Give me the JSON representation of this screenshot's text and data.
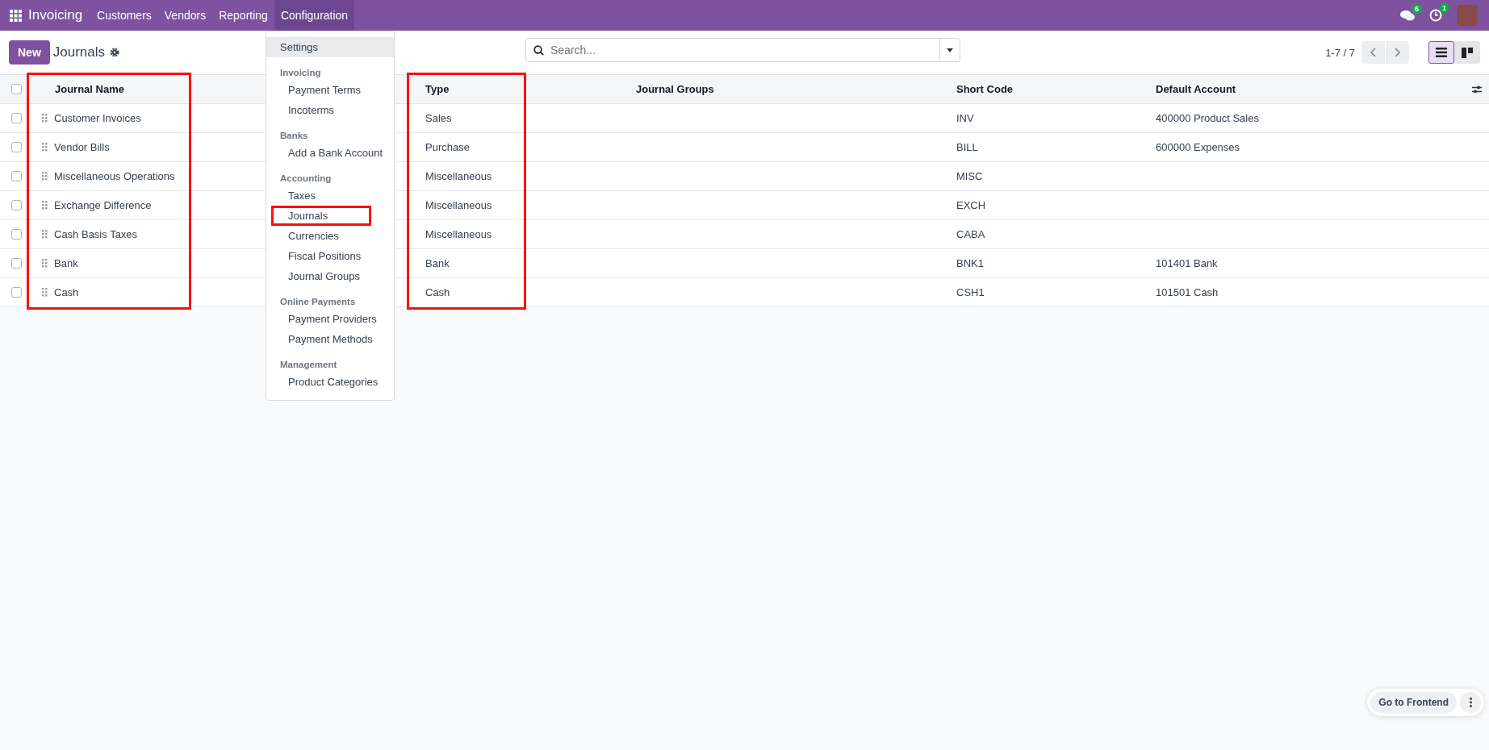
{
  "navbar": {
    "app": "Invoicing",
    "menus": [
      {
        "label": "Customers",
        "selected": false
      },
      {
        "label": "Vendors",
        "selected": false
      },
      {
        "label": "Reporting",
        "selected": false
      },
      {
        "label": "Configuration",
        "selected": true
      }
    ],
    "chat_badge": "6",
    "activity_badge": "1"
  },
  "control_panel": {
    "new_button": "New",
    "title": "Journals",
    "search": {
      "placeholder": "Search..."
    },
    "pager": "1-7 / 7",
    "views": [
      {
        "kind": "list",
        "selected": true
      },
      {
        "kind": "kanban",
        "selected": false
      }
    ]
  },
  "table": {
    "select_all": {
      "checked": false
    },
    "columns": [
      {
        "label": "Journal Name",
        "highlighted": true
      },
      {
        "label": "Type",
        "highlighted": true
      },
      {
        "label": "Journal Groups",
        "highlighted": false
      },
      {
        "label": "Short Code",
        "highlighted": false
      },
      {
        "label": "Default Account",
        "highlighted": false
      }
    ],
    "rows": [
      {
        "checked": false,
        "cells": [
          "Customer Invoices",
          "Sales",
          "",
          "INV",
          "400000 Product Sales"
        ]
      },
      {
        "checked": false,
        "cells": [
          "Vendor Bills",
          "Purchase",
          "",
          "BILL",
          "600000 Expenses"
        ]
      },
      {
        "checked": false,
        "cells": [
          "Miscellaneous Operations",
          "Miscellaneous",
          "",
          "MISC",
          ""
        ]
      },
      {
        "checked": false,
        "cells": [
          "Exchange Difference",
          "Miscellaneous",
          "",
          "EXCH",
          ""
        ]
      },
      {
        "checked": false,
        "cells": [
          "Cash Basis Taxes",
          "Miscellaneous",
          "",
          "CABA",
          ""
        ]
      },
      {
        "checked": false,
        "cells": [
          "Bank",
          "Bank",
          "",
          "BNK1",
          "101401 Bank"
        ]
      },
      {
        "checked": false,
        "cells": [
          "Cash",
          "Cash",
          "",
          "CSH1",
          "101501 Cash"
        ]
      }
    ]
  },
  "menu": {
    "items": [
      {
        "kind": "item",
        "label": "Settings",
        "selected": true,
        "highlighted": false
      },
      {
        "kind": "header",
        "label": "Invoicing"
      },
      {
        "kind": "item",
        "label": "Payment Terms",
        "selected": false,
        "highlighted": false
      },
      {
        "kind": "item",
        "label": "Incoterms",
        "selected": false,
        "highlighted": false
      },
      {
        "kind": "header",
        "label": "Banks"
      },
      {
        "kind": "item",
        "label": "Add a Bank Account",
        "selected": false,
        "highlighted": false
      },
      {
        "kind": "header",
        "label": "Accounting"
      },
      {
        "kind": "item",
        "label": "Taxes",
        "selected": false,
        "highlighted": false
      },
      {
        "kind": "item",
        "label": "Journals",
        "selected": false,
        "highlighted": true
      },
      {
        "kind": "item",
        "label": "Currencies",
        "selected": false,
        "highlighted": false
      },
      {
        "kind": "item",
        "label": "Fiscal Positions",
        "selected": false,
        "highlighted": false
      },
      {
        "kind": "item",
        "label": "Journal Groups",
        "selected": false,
        "highlighted": false
      },
      {
        "kind": "header",
        "label": "Online Payments"
      },
      {
        "kind": "item",
        "label": "Payment Providers",
        "selected": false,
        "highlighted": false
      },
      {
        "kind": "item",
        "label": "Payment Methods",
        "selected": false,
        "highlighted": false
      },
      {
        "kind": "header",
        "label": "Management"
      },
      {
        "kind": "item",
        "label": "Product Categories",
        "selected": false,
        "highlighted": false
      }
    ]
  },
  "floating": {
    "button": "Go to Frontend"
  }
}
